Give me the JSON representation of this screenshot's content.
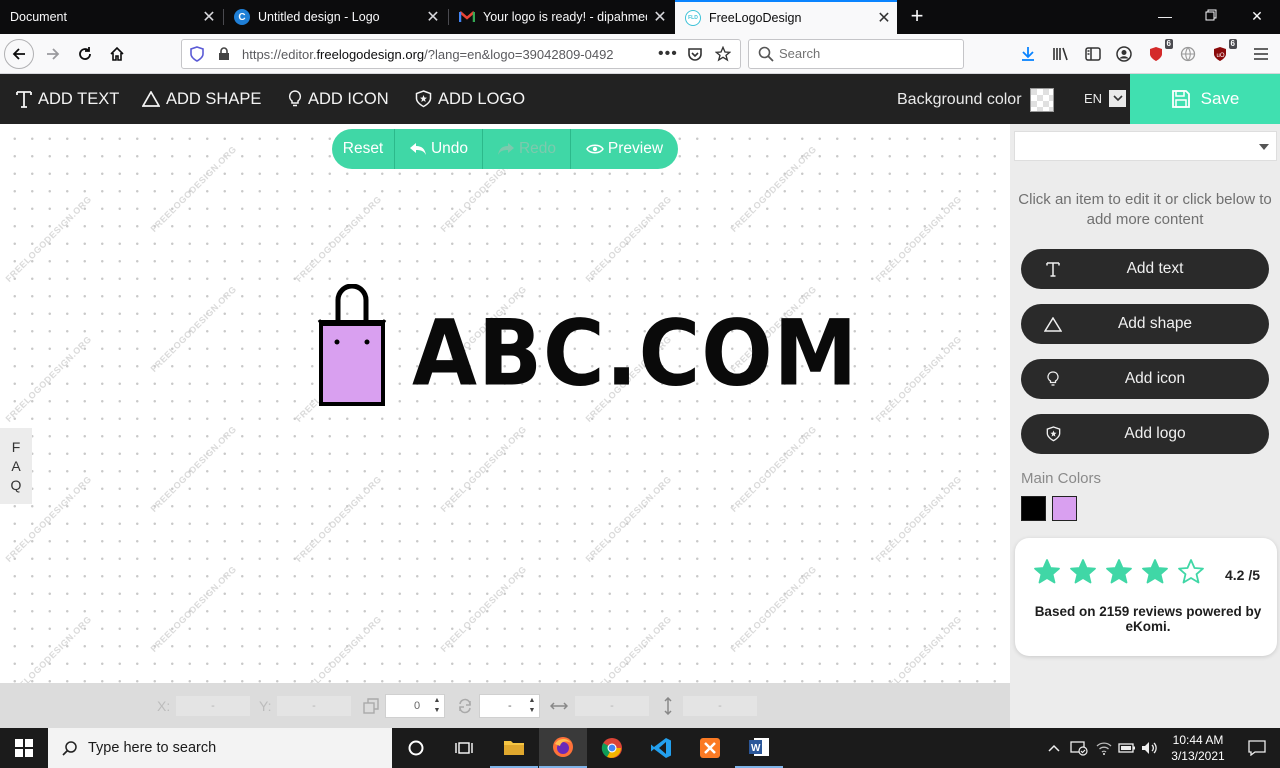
{
  "browser": {
    "tabs": [
      {
        "title": "Document",
        "favicon": "none",
        "active": false
      },
      {
        "title": "Untitled design - Logo",
        "favicon": "canva-icon",
        "active": false
      },
      {
        "title": "Your logo is ready! - dipahmed",
        "favicon": "gmail-icon",
        "active": false
      },
      {
        "title": "FreeLogoDesign",
        "favicon": "freelogodesign-icon",
        "active": true
      }
    ],
    "url_prefix": "https://editor.",
    "url_domain": "freelogodesign.org",
    "url_rest": "/?lang=en&logo=39042809-0492",
    "search_placeholder": "Search",
    "addon_badges": {
      "ublock": "6",
      "extension": "6"
    }
  },
  "toolbar": {
    "add_text": "ADD TEXT",
    "add_shape": "ADD SHAPE",
    "add_icon": "ADD ICON",
    "add_logo": "ADD LOGO",
    "background_color_label": "Background color",
    "language": "EN",
    "save": "Save"
  },
  "canvas": {
    "actions": {
      "reset": "Reset",
      "undo": "Undo",
      "redo": "Redo",
      "preview": "Preview"
    },
    "logo_text": "ABC.COM",
    "watermark": "FREELOGODESIGN.ORG",
    "faq": [
      "F",
      "A",
      "Q"
    ]
  },
  "coordbar": {
    "x_label": "X:",
    "x_value": "-",
    "y_label": "Y:",
    "y_value": "-",
    "layer_value": "0",
    "rotation_value": "-",
    "width_value": "-",
    "height_value": "-"
  },
  "panel": {
    "hint": "Click an item to edit it or click below to add more content",
    "buttons": {
      "text": "Add text",
      "shape": "Add shape",
      "icon": "Add icon",
      "logo": "Add logo"
    },
    "main_colors_label": "Main Colors",
    "main_colors": [
      "#000000",
      "#d9a0f0"
    ],
    "rating": {
      "score": "4.2 /5",
      "stars_filled": 4,
      "stars_total": 5,
      "text": "Based on 2159 reviews powered by eKomi."
    }
  },
  "colors": {
    "accent": "#40d7a6",
    "toolbar_bg": "#222222",
    "bag_fill": "#d9a0f0"
  },
  "taskbar": {
    "search_placeholder": "Type here to search",
    "time": "10:44 AM",
    "date": "3/13/2021"
  }
}
